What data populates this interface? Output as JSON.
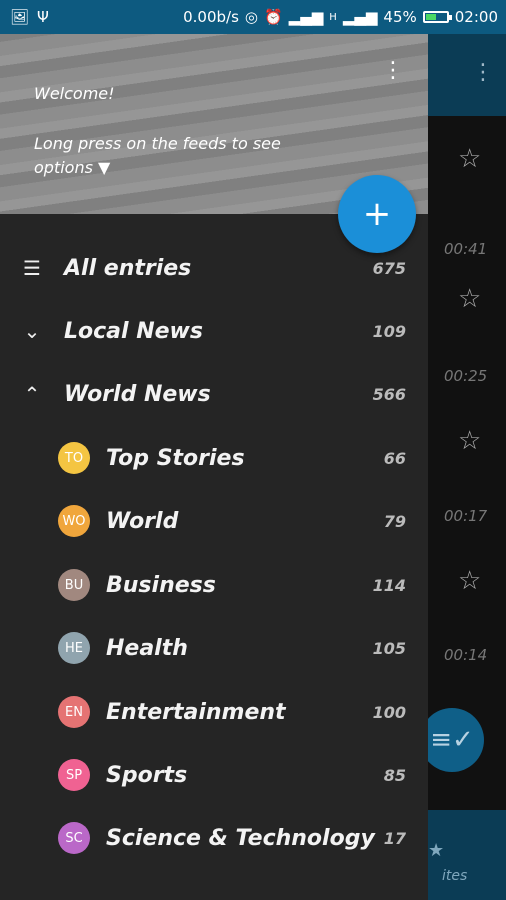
{
  "status_bar": {
    "network_speed": "0.00b/s",
    "network_type": "H",
    "battery_percent": "45%",
    "time": "02:00",
    "icons": [
      "image-icon",
      "usb-icon",
      "hotspot-icon",
      "alarm-icon",
      "signal-icon",
      "signal-icon-2",
      "battery-icon"
    ]
  },
  "drawer": {
    "header": {
      "welcome": "Welcome!",
      "hint_line1": "Long press on the feeds to see",
      "hint_line2": "options ▼"
    },
    "items": [
      {
        "type": "top",
        "icon": "list-icon",
        "label": "All entries",
        "count": "675"
      },
      {
        "type": "group",
        "icon": "chevron-down-icon",
        "label": "Local News",
        "count": "109"
      },
      {
        "type": "group",
        "icon": "chevron-up-icon",
        "label": "World News",
        "count": "566"
      }
    ],
    "feeds": [
      {
        "abbr": "TO",
        "label": "Top Stories",
        "count": "66",
        "color": "#f4c542"
      },
      {
        "abbr": "WO",
        "label": "World",
        "count": "79",
        "color": "#f0a63c"
      },
      {
        "abbr": "BU",
        "label": "Business",
        "count": "114",
        "color": "#a1887f"
      },
      {
        "abbr": "HE",
        "label": "Health",
        "count": "105",
        "color": "#90a4ae"
      },
      {
        "abbr": "EN",
        "label": "Entertainment",
        "count": "100",
        "color": "#e57373"
      },
      {
        "abbr": "SP",
        "label": "Sports",
        "count": "85",
        "color": "#f06292"
      },
      {
        "abbr": "SC",
        "label": "Science & Technology",
        "count": "17",
        "color": "#ba68c8"
      }
    ]
  },
  "background_list": {
    "times": [
      "00:41",
      "00:25",
      "00:17",
      "00:14"
    ],
    "bottom_tab": "ites"
  },
  "colors": {
    "statusbar": "#0d5a80",
    "fab": "#1b8fd8",
    "drawer": "#252525"
  }
}
